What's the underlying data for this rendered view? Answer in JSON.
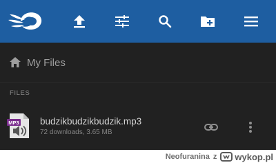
{
  "colors": {
    "toolbar_bg": "#1e5ea1",
    "app_bg": "#212121",
    "mp3_badge": "#7b2e8e"
  },
  "toolbar": {
    "logo": "mediafire-logo",
    "icons": [
      "upload-icon",
      "filter-icon",
      "search-icon",
      "new-folder-icon",
      "menu-icon"
    ]
  },
  "breadcrumb": {
    "icon": "home-icon",
    "label": "My Files"
  },
  "files_section": {
    "label": "FILES",
    "items": [
      {
        "icon": "mp3-file-icon",
        "badge": "MP3",
        "name": "budzikbudzikbudzik.mp3",
        "meta": "72 downloads, 3.65 MB",
        "actions": [
          "link-icon",
          "more-vert-icon"
        ]
      }
    ]
  },
  "watermark": {
    "user": "Neofuranina",
    "separator": "z",
    "site": "wykop.pl"
  }
}
